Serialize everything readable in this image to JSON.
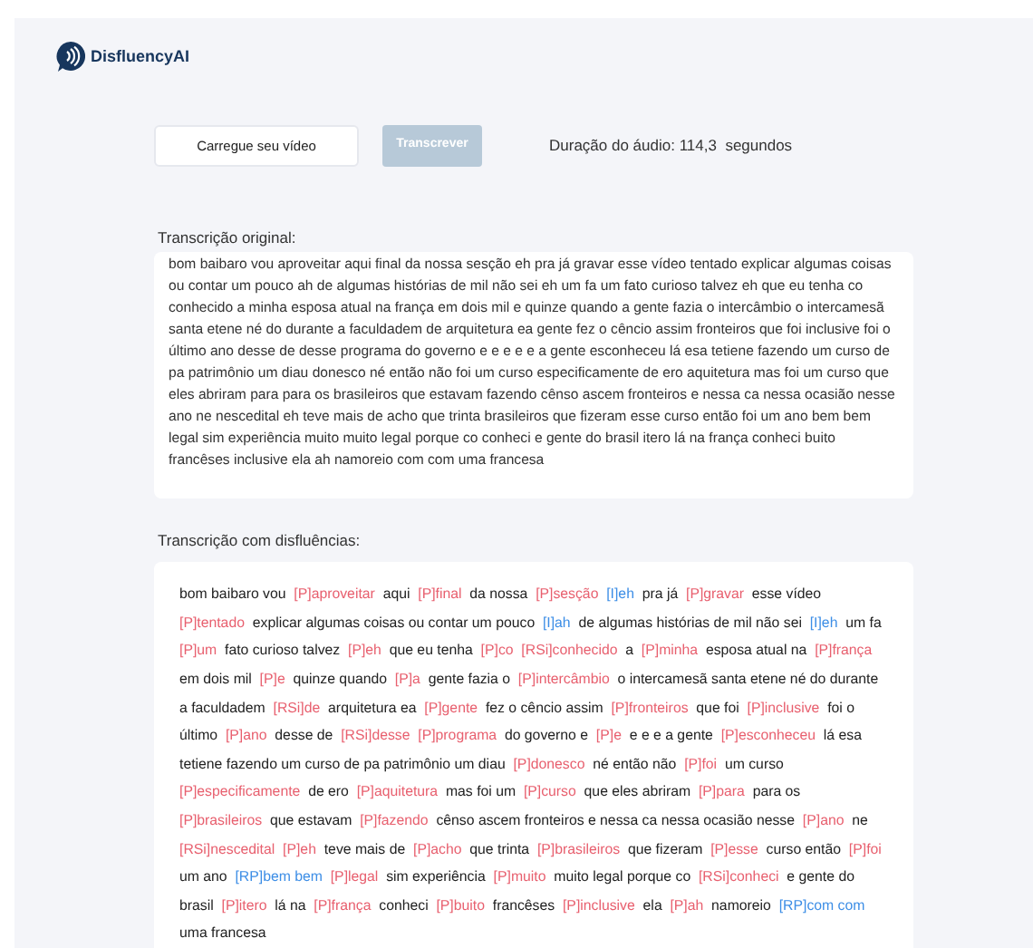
{
  "brand": {
    "name": "DisfluencyAI"
  },
  "upload_button": {
    "label": "Carregue seu vídeo"
  },
  "transcribe_button": {
    "label": "Transcrever",
    "disabled": true
  },
  "duration": "Duração do áudio: 114,3  segundos",
  "original": {
    "title": "Transcrição original:",
    "text": "bom baibaro vou aproveitar aqui final da nossa sesção eh pra já gravar esse vídeo tentado explicar algumas coisas ou contar um pouco ah de algumas histórias de mil não sei eh um fa um fato curioso talvez eh que eu tenha co conhecido a minha esposa atual na frança em dois mil e quinze quando a gente fazia o intercâmbio o intercamesã santa etene né do durante a faculdadem de arquitetura ea gente fez o cêncio assim fronteiros que foi inclusive foi o último ano desse de desse programa do governo e e e e e a gente esconheceu lá esa tetiene fazendo um curso de pa patrimônio um diau donesco né então não foi um curso especificamente de ero aquitetura mas foi um curso que eles abriram para para os brasileiros que estavam fazendo cênso ascem fronteiros e nessa ca nessa ocasião nesse ano ne nescedital eh teve mais de acho que trinta brasileiros que fizeram esse curso então foi um ano bem bem legal sim experiência muito muito legal porque co conheci e gente do brasil itero lá na frança conheci buito francêses inclusive ela ah namoreio com com uma francesa"
  },
  "disfluent": {
    "title": "Transcrição com disfluências:",
    "segments": [
      {
        "kind": "text",
        "text": "bom baibaro vou"
      },
      {
        "kind": "p",
        "text": "[P]aproveitar"
      },
      {
        "kind": "text",
        "text": "aqui"
      },
      {
        "kind": "p",
        "text": "[P]final"
      },
      {
        "kind": "text",
        "text": "da nossa"
      },
      {
        "kind": "p",
        "text": "[P]sesção"
      },
      {
        "kind": "i",
        "text": "[I]eh"
      },
      {
        "kind": "text",
        "text": "pra já"
      },
      {
        "kind": "p",
        "text": "[P]gravar"
      },
      {
        "kind": "text",
        "text": "esse vídeo"
      },
      {
        "kind": "p",
        "text": "[P]tentado"
      },
      {
        "kind": "text",
        "text": "explicar algumas coisas ou contar um pouco"
      },
      {
        "kind": "i",
        "text": "[I]ah"
      },
      {
        "kind": "text",
        "text": "de algumas histórias de mil não sei"
      },
      {
        "kind": "i",
        "text": "[I]eh"
      },
      {
        "kind": "text",
        "text": "um fa"
      },
      {
        "kind": "p",
        "text": "[P]um"
      },
      {
        "kind": "text",
        "text": "fato curioso talvez"
      },
      {
        "kind": "p",
        "text": "[P]eh"
      },
      {
        "kind": "text",
        "text": "que eu tenha"
      },
      {
        "kind": "p",
        "text": "[P]co"
      },
      {
        "kind": "rsi",
        "text": "[RSi]conhecido"
      },
      {
        "kind": "text",
        "text": "a"
      },
      {
        "kind": "p",
        "text": "[P]minha"
      },
      {
        "kind": "text",
        "text": "esposa atual na"
      },
      {
        "kind": "p",
        "text": "[P]frança"
      },
      {
        "kind": "text",
        "text": "em dois mil"
      },
      {
        "kind": "p",
        "text": "[P]e"
      },
      {
        "kind": "text",
        "text": "quinze quando"
      },
      {
        "kind": "p",
        "text": "[P]a"
      },
      {
        "kind": "text",
        "text": "gente fazia o"
      },
      {
        "kind": "p",
        "text": "[P]intercâmbio"
      },
      {
        "kind": "text",
        "text": "o intercamesã santa etene né do durante a faculdadem"
      },
      {
        "kind": "rsi",
        "text": "[RSi]de"
      },
      {
        "kind": "text",
        "text": "arquitetura ea"
      },
      {
        "kind": "p",
        "text": "[P]gente"
      },
      {
        "kind": "text",
        "text": "fez o cêncio assim"
      },
      {
        "kind": "p",
        "text": "[P]fronteiros"
      },
      {
        "kind": "text",
        "text": "que foi"
      },
      {
        "kind": "p",
        "text": "[P]inclusive"
      },
      {
        "kind": "text",
        "text": "foi o último"
      },
      {
        "kind": "p",
        "text": "[P]ano"
      },
      {
        "kind": "text",
        "text": "desse de"
      },
      {
        "kind": "rsi",
        "text": "[RSi]desse"
      },
      {
        "kind": "p",
        "text": "[P]programa"
      },
      {
        "kind": "text",
        "text": "do governo e"
      },
      {
        "kind": "p",
        "text": "[P]e"
      },
      {
        "kind": "text",
        "text": "e e e a gente"
      },
      {
        "kind": "p",
        "text": "[P]esconheceu"
      },
      {
        "kind": "text",
        "text": "lá esa tetiene fazendo um curso de pa patrimônio um diau"
      },
      {
        "kind": "p",
        "text": "[P]donesco"
      },
      {
        "kind": "text",
        "text": "né então não"
      },
      {
        "kind": "p",
        "text": "[P]foi"
      },
      {
        "kind": "text",
        "text": "um curso"
      },
      {
        "kind": "p",
        "text": "[P]especificamente"
      },
      {
        "kind": "text",
        "text": "de ero"
      },
      {
        "kind": "p",
        "text": "[P]aquitetura"
      },
      {
        "kind": "text",
        "text": "mas foi um"
      },
      {
        "kind": "p",
        "text": "[P]curso"
      },
      {
        "kind": "text",
        "text": "que eles abriram"
      },
      {
        "kind": "p",
        "text": "[P]para"
      },
      {
        "kind": "text",
        "text": "para os"
      },
      {
        "kind": "p",
        "text": "[P]brasileiros"
      },
      {
        "kind": "text",
        "text": "que estavam"
      },
      {
        "kind": "p",
        "text": "[P]fazendo"
      },
      {
        "kind": "text",
        "text": "cênso ascem fronteiros e nessa ca nessa ocasião nesse"
      },
      {
        "kind": "p",
        "text": "[P]ano"
      },
      {
        "kind": "text",
        "text": "ne"
      },
      {
        "kind": "rsi",
        "text": "[RSi]nescedital"
      },
      {
        "kind": "p",
        "text": "[P]eh"
      },
      {
        "kind": "text",
        "text": "teve mais de"
      },
      {
        "kind": "p",
        "text": "[P]acho"
      },
      {
        "kind": "text",
        "text": "que trinta"
      },
      {
        "kind": "p",
        "text": "[P]brasileiros"
      },
      {
        "kind": "text",
        "text": "que fizeram"
      },
      {
        "kind": "p",
        "text": "[P]esse"
      },
      {
        "kind": "text",
        "text": "curso então"
      },
      {
        "kind": "p",
        "text": "[P]foi"
      },
      {
        "kind": "text",
        "text": "um ano"
      },
      {
        "kind": "rp",
        "text": "[RP]bem bem"
      },
      {
        "kind": "p",
        "text": "[P]legal"
      },
      {
        "kind": "text",
        "text": "sim experiência"
      },
      {
        "kind": "p",
        "text": "[P]muito"
      },
      {
        "kind": "text",
        "text": "muito legal porque co"
      },
      {
        "kind": "rsi",
        "text": "[RSi]conheci"
      },
      {
        "kind": "text",
        "text": "e gente do brasil"
      },
      {
        "kind": "p",
        "text": "[P]itero"
      },
      {
        "kind": "text",
        "text": "lá na"
      },
      {
        "kind": "p",
        "text": "[P]frança"
      },
      {
        "kind": "text",
        "text": "conheci"
      },
      {
        "kind": "p",
        "text": "[P]buito"
      },
      {
        "kind": "text",
        "text": "francêses"
      },
      {
        "kind": "p",
        "text": "[P]inclusive"
      },
      {
        "kind": "text",
        "text": "ela"
      },
      {
        "kind": "p",
        "text": "[P]ah"
      },
      {
        "kind": "text",
        "text": "namoreio"
      },
      {
        "kind": "rp",
        "text": "[RP]com com"
      },
      {
        "kind": "text",
        "text": "uma francesa"
      }
    ]
  }
}
